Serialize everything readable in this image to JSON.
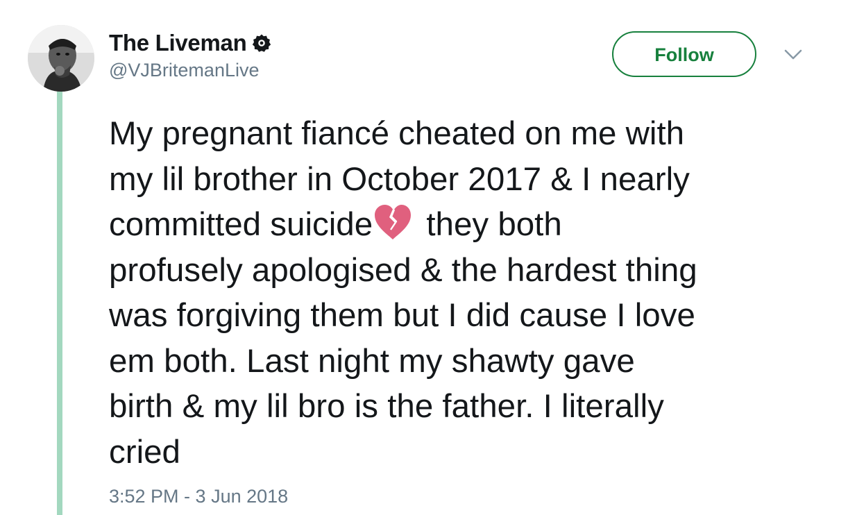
{
  "author": {
    "display_name": "The Liveman",
    "handle": "@VJBritemanLive",
    "verified": true,
    "avatar_icon": "avatar-photo"
  },
  "actions": {
    "follow_label": "Follow",
    "menu_icon": "chevron-down-icon"
  },
  "tweet": {
    "lines": [
      "My pregnant fiancé cheated on me with",
      "my lil brother in October 2017 & I nearly",
      "committed suicide",
      "profusely apologised & the hardest thing",
      "was forgiving them but I did cause I love",
      "em both. Last night my shawty gave",
      "birth & my lil bro is the father. I literally",
      "cried"
    ],
    "line3_after_emoji": " they both",
    "emoji": "broken-heart-icon",
    "timestamp": "3:52 PM - 3 Jun 2018"
  },
  "colors": {
    "accent": "#17803d",
    "thread_line": "#a3d8bf",
    "secondary_text": "#657786",
    "primary_text": "#14171a",
    "emoji": "#e0607e"
  }
}
